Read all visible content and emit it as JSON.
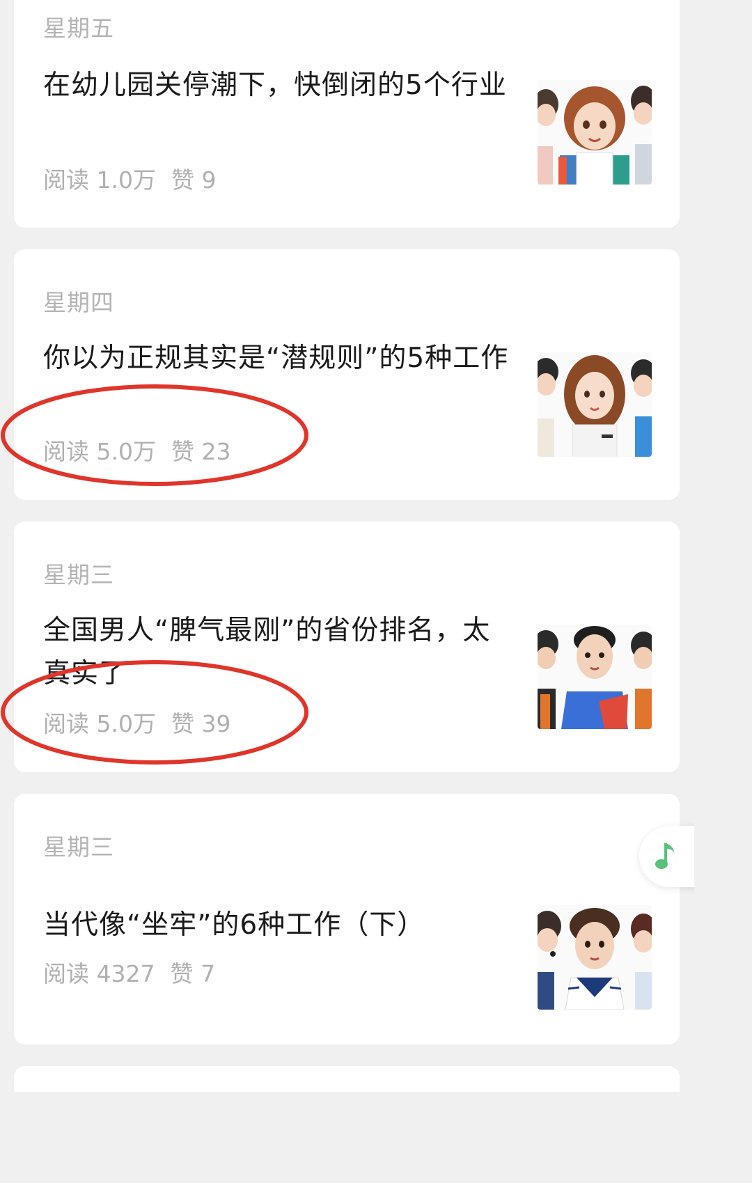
{
  "articles": [
    {
      "day": "星期五",
      "title": "在幼儿园关停潮下，快倒闭的5个行业",
      "reads": "阅读 1.0万",
      "likes": "赞 9",
      "thumbnail": "cartoon-woman-apron-icon"
    },
    {
      "day": "星期四",
      "title": "你以为正规其实是“潜规则”的5种工作",
      "reads": "阅读 5.0万",
      "likes": "赞 23",
      "thumbnail": "cartoon-woman-lace-icon"
    },
    {
      "day": "星期三",
      "title": "全国男人“脾气最刚”的省份排名，太真实了",
      "reads": "阅读 5.0万",
      "likes": "赞 39",
      "thumbnail": "cartoon-man-blue-shirt-icon"
    },
    {
      "day": "星期三",
      "title": "当代像“坐牢”的6种工作（下）",
      "reads": "阅读 4327",
      "likes": "赞 7",
      "thumbnail": "cartoon-man-sailor-icon"
    }
  ],
  "annotation_color": "#e0352b",
  "floating_button": {
    "icon": "music-note-icon",
    "color": "#5bbf7d"
  }
}
